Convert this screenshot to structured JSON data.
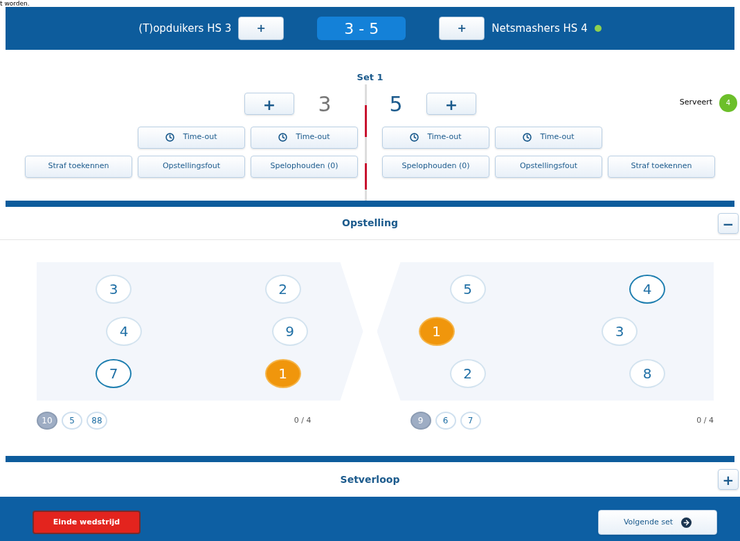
{
  "page_text": "t worden.",
  "header": {
    "home": {
      "name": "(T)opduikers HS 3",
      "add": "+",
      "serving": false
    },
    "score": "3 - 5",
    "away": {
      "name": "Netsmashers HS 4",
      "add": "+",
      "serving": true
    }
  },
  "set": {
    "title": "Set 1",
    "home": {
      "add": "+",
      "points": "3",
      "serving": false,
      "timeouts": [
        "Time-out",
        "Time-out"
      ],
      "actions": [
        "Straf toekennen",
        "Opstellingsfout",
        "Spelophouden (0)"
      ]
    },
    "away": {
      "add": "+",
      "points": "5",
      "serving": true,
      "timeouts": [
        "Time-out",
        "Time-out"
      ],
      "actions": [
        "Spelophouden (0)",
        "Opstellingsfout",
        "Straf toekennen"
      ]
    },
    "server": {
      "label": "Serveert",
      "badge": "4"
    }
  },
  "lineup": {
    "title": "Opstelling",
    "toggle": "−",
    "courts": [
      {
        "rows": [
          [
            {
              "number": "3",
              "kind": "player"
            },
            {
              "number": "2",
              "kind": "player"
            }
          ],
          [
            {
              "number": "4",
              "kind": "player"
            },
            {
              "number": "9",
              "kind": "player"
            }
          ],
          [
            {
              "number": "7",
              "kind": "captain"
            },
            {
              "number": "1",
              "kind": "libero"
            }
          ]
        ],
        "bench": [
          {
            "number": "10",
            "kind": "out"
          },
          {
            "number": "5",
            "kind": "player"
          },
          {
            "number": "88",
            "kind": "player"
          }
        ],
        "count": "0 / 4"
      },
      {
        "rows": [
          [
            {
              "number": "5",
              "kind": "player"
            },
            {
              "number": "4",
              "kind": "captain"
            }
          ],
          [
            {
              "number": "1",
              "kind": "libero"
            },
            {
              "number": "3",
              "kind": "player"
            }
          ],
          [
            {
              "number": "2",
              "kind": "player"
            },
            {
              "number": "8",
              "kind": "player"
            }
          ]
        ],
        "bench": [
          {
            "number": "9",
            "kind": "out"
          },
          {
            "number": "6",
            "kind": "player"
          },
          {
            "number": "7",
            "kind": "player"
          }
        ],
        "count": "0 / 4"
      }
    ]
  },
  "progress": {
    "title": "Setverloop",
    "toggle": "+"
  },
  "footer": {
    "end": "Einde wedstrijd",
    "next": "Volgende set"
  }
}
